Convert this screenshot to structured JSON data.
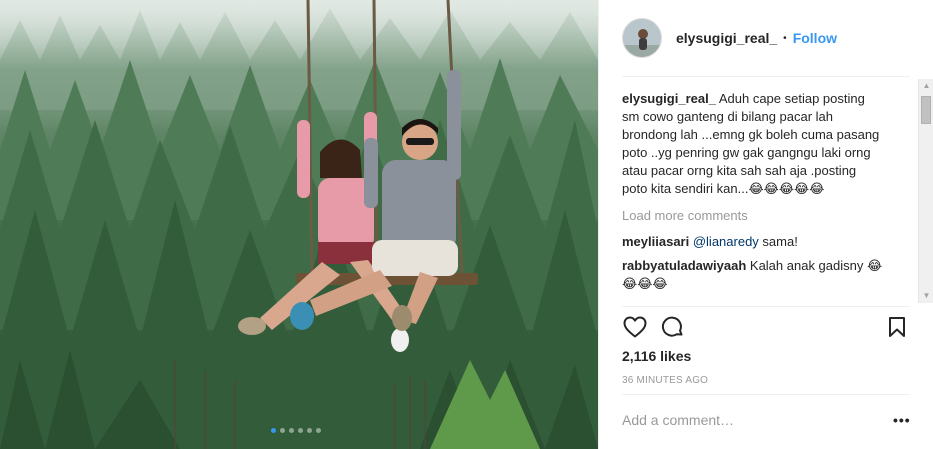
{
  "post": {
    "username": "elysugigi_real_",
    "follow_label": "Follow",
    "separator": "•",
    "caption_username": "elysugigi_real_",
    "caption_text": " Aduh cape setiap posting sm cowo ganteng di bilang pacar lah brondong lah ...emng gk boleh cuma pasang poto ..yg penring gw gak gangngu laki orng atau pacar orng kita sah sah aja .posting poto kita sendiri kan...😂😂😂😂😂",
    "load_more_label": "Load more comments",
    "comments": [
      {
        "user": "meyliiasari",
        "mention": "@lianaredy",
        "text": " sama!"
      },
      {
        "user": "rabbyatuladawiyaah",
        "text": " Kalah anak gadisny 😂😂😂😂"
      }
    ],
    "likes": "2,116 likes",
    "time": "36 MINUTES AGO",
    "add_comment_placeholder": "Add a comment…",
    "more_options": "•••",
    "carousel_dots": 6,
    "carousel_active_index": 0
  },
  "icons": {
    "like": "heart-icon",
    "comment": "comment-icon",
    "save": "bookmark-icon",
    "more": "more-options-icon"
  },
  "colors": {
    "accent": "#3897f0",
    "text": "#262626",
    "muted": "#999999",
    "divider": "#efefef"
  }
}
